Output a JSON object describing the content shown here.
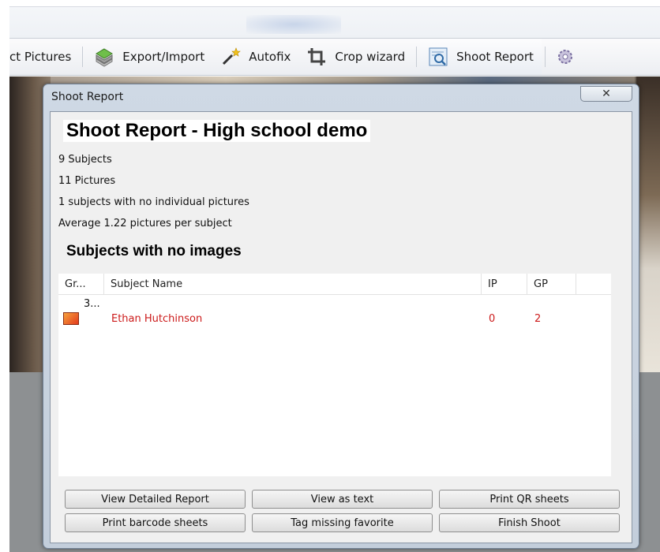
{
  "toolbar": {
    "items": [
      {
        "label": "ct Pictures",
        "icon": "pictures-icon"
      },
      {
        "label": "Export/Import",
        "icon": "export-import-icon"
      },
      {
        "label": "Autofix",
        "icon": "magic-wand-icon"
      },
      {
        "label": "Crop wizard",
        "icon": "crop-icon"
      },
      {
        "label": "Shoot Report",
        "icon": "report-icon"
      }
    ]
  },
  "dialog": {
    "title": "Shoot Report",
    "close_label": "✕",
    "heading": "Shoot Report - High school demo",
    "stats": {
      "subjects": "9 Subjects",
      "pictures": "11 Pictures",
      "no_individual": "1 subjects with no individual pictures",
      "average": "Average 1.22 pictures per subject"
    },
    "section_title": "Subjects with no images",
    "table": {
      "columns": [
        "Gr...",
        "Subject Name",
        "IP",
        "GP"
      ],
      "rows": [
        {
          "group": "3...",
          "name": "Ethan Hutchinson",
          "ip": "0",
          "gp": "2"
        }
      ]
    },
    "buttons": {
      "view_detailed": "View Detailed Report",
      "view_text": "View as text",
      "print_qr": "Print QR sheets",
      "print_barcode": "Print barcode sheets",
      "tag_missing": "Tag missing favorite",
      "finish": "Finish Shoot"
    }
  },
  "colors": {
    "accent_red": "#cc1a1a",
    "dialog_frame": "#c3cedb"
  }
}
